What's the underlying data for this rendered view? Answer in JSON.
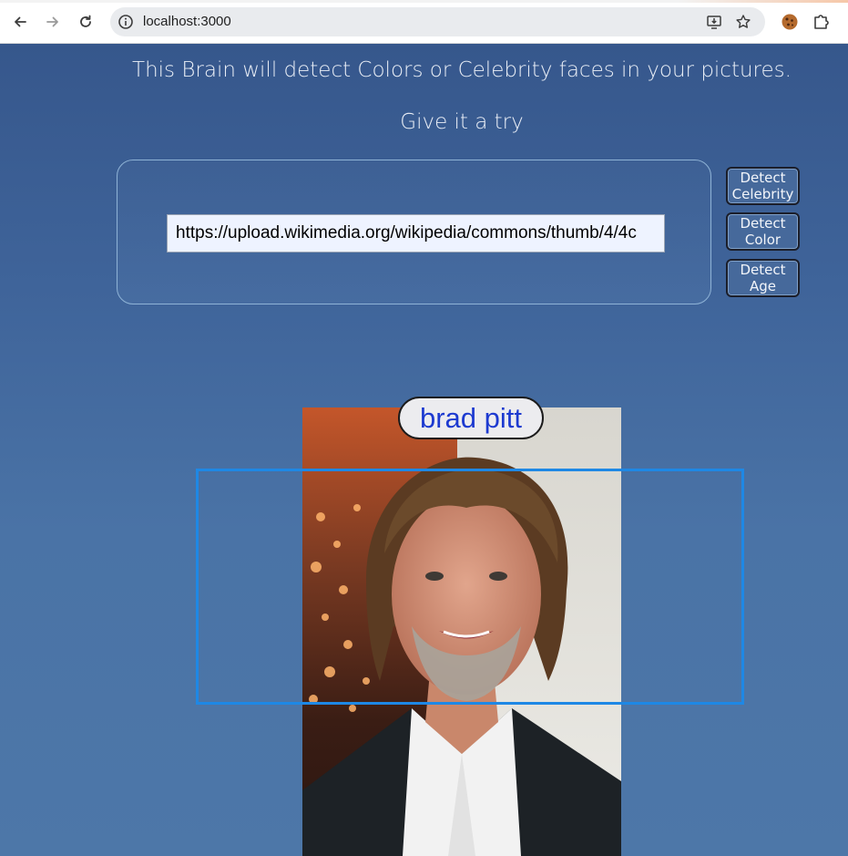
{
  "browser": {
    "url": "localhost:3000",
    "back_icon": "arrow-left-icon",
    "forward_icon": "arrow-right-icon",
    "reload_icon": "reload-icon",
    "info_icon": "info-icon",
    "install_icon": "install-app-icon",
    "bookmark_icon": "star-icon",
    "cookie_extension_icon": "cookie-icon",
    "extensions_icon": "puzzle-icon"
  },
  "page": {
    "tagline": "This Brain will detect Colors or Celebrity faces in your pictures.",
    "subtagline": "Give it a try",
    "image_url_input": {
      "value": "https://upload.wikimedia.org/wikipedia/commons/thumb/4/4c",
      "placeholder": ""
    },
    "buttons": {
      "detect_celebrity": "Detect Celebrity",
      "detect_color": "Detect Color",
      "detect_age": "Detect Age"
    },
    "result": {
      "celebrity_name": "brad pitt"
    },
    "colors": {
      "background_top": "#36578c",
      "background_bottom": "#4d77a8",
      "face_box": "#1e88e5",
      "name_text": "#1d3ad0"
    }
  }
}
